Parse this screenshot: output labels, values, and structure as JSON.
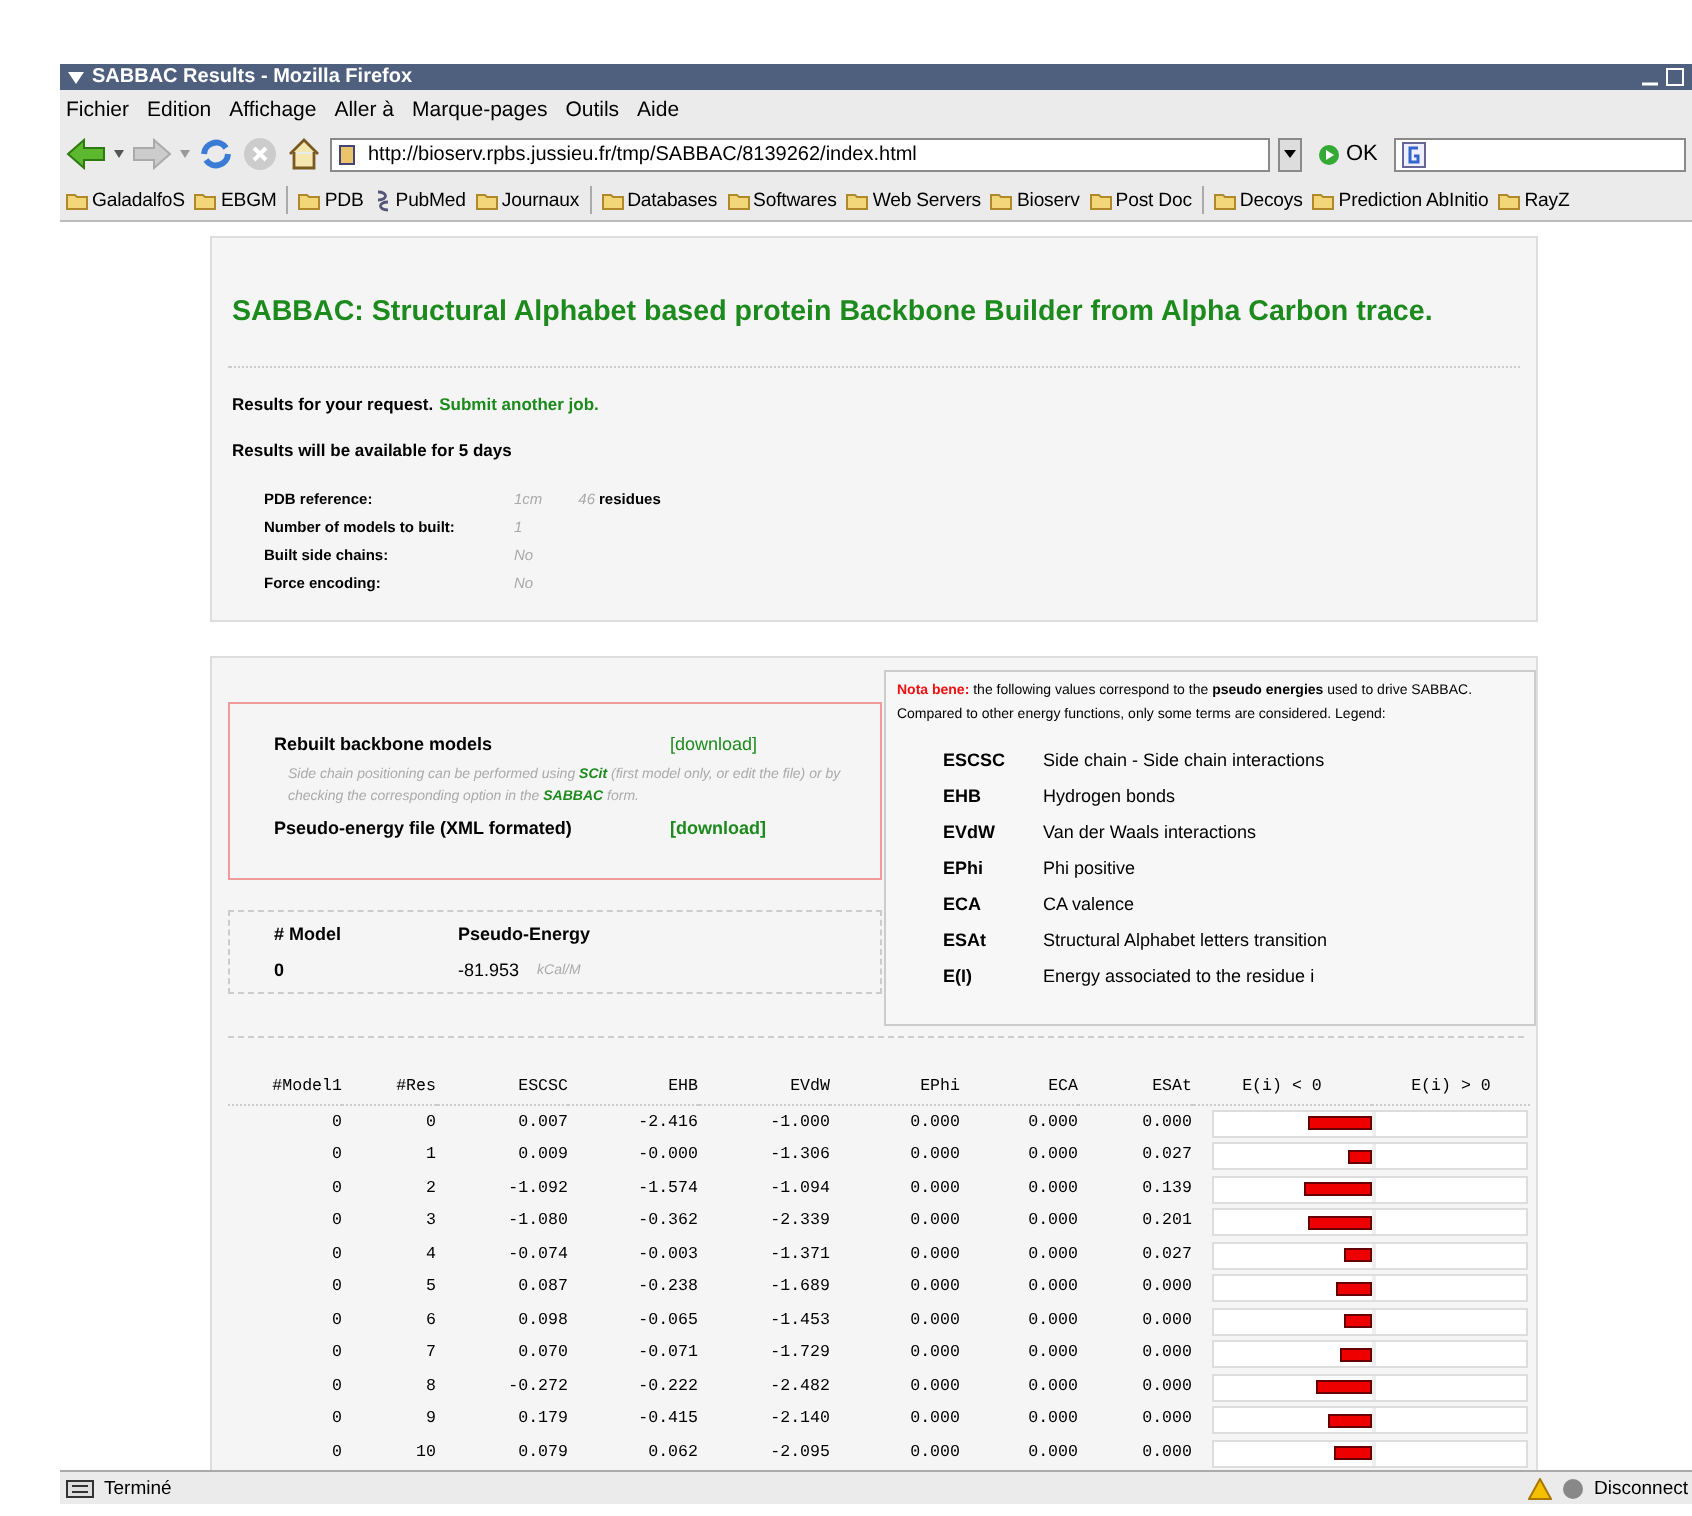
{
  "window": {
    "title": "SABBAC Results - Mozilla Firefox"
  },
  "menu": [
    "Fichier",
    "Edition",
    "Affichage",
    "Aller à",
    "Marque-pages",
    "Outils",
    "Aide"
  ],
  "toolbar": {
    "url": "http://bioserv.rpbs.jussieu.fr/tmp/SABBAC/8139262/index.html",
    "go": "OK"
  },
  "bookmarks": [
    {
      "label": "GaladalfoS",
      "kind": "folder",
      "separator_after": false
    },
    {
      "label": "EBGM",
      "kind": "folder",
      "separator_after": true
    },
    {
      "label": "PDB",
      "kind": "folder",
      "separator_after": false
    },
    {
      "label": "PubMed",
      "kind": "link",
      "separator_after": false
    },
    {
      "label": "Journaux",
      "kind": "folder",
      "separator_after": true
    },
    {
      "label": "Databases",
      "kind": "folder",
      "separator_after": false
    },
    {
      "label": "Softwares",
      "kind": "folder",
      "separator_after": false
    },
    {
      "label": "Web Servers",
      "kind": "folder",
      "separator_after": false
    },
    {
      "label": "Bioserv",
      "kind": "folder",
      "separator_after": false
    },
    {
      "label": "Post Doc",
      "kind": "folder",
      "separator_after": true
    },
    {
      "label": "Decoys",
      "kind": "folder",
      "separator_after": false
    },
    {
      "label": "Prediction AbInitio",
      "kind": "folder",
      "separator_after": false
    },
    {
      "label": "RayZ",
      "kind": "folder",
      "separator_after": false
    }
  ],
  "page": {
    "heading": "SABBAC: Structural Alphabet based protein Backbone Builder from Alpha Carbon trace.",
    "request": {
      "text": "Results for your request.",
      "link": "Submit another job."
    },
    "availability": "Results will be available for 5 days",
    "parameters": [
      {
        "label": "PDB reference:",
        "value": "1cm",
        "count": "46",
        "unit": "residues"
      },
      {
        "label": "Number of models to built:",
        "value": "1"
      },
      {
        "label": "Built side chains:",
        "value": "No"
      },
      {
        "label": "Force encoding:",
        "value": "No"
      }
    ],
    "downloads": [
      {
        "label": "Rebuilt backbone models",
        "link": "[download]",
        "note": [
          {
            "kind": "text",
            "text": "Side chain positioning can be performed using "
          },
          {
            "kind": "link",
            "text": "SCit"
          },
          {
            "kind": "text",
            "text": " (first model only, or edit the file) or by checking the corresponding option in the "
          },
          {
            "kind": "link",
            "text": "SABBAC"
          },
          {
            "kind": "text",
            "text": " form."
          }
        ]
      },
      {
        "label": "Pseudo-energy file (XML formated)",
        "link": "[download]"
      }
    ],
    "energy_table": {
      "columns": [
        "# Model",
        "Pseudo-Energy"
      ],
      "rows": [
        {
          "model": "0",
          "energy": "-81.953",
          "unit": "kCal/M"
        }
      ]
    },
    "nota": {
      "text": "**Nota bene:** the following values correspond to the **pseudo energies** used to drive SABBAC. Compared to other energy functions, only some terms are considered. Legend:"
    },
    "legend": [
      {
        "term": "ESCSC",
        "meaning": "Side chain - Side chain interactions"
      },
      {
        "term": "EHB",
        "meaning": "Hydrogen bonds"
      },
      {
        "term": "EVdW",
        "meaning": "Van der Waals interactions"
      },
      {
        "term": "EPhi",
        "meaning": "Phi positive"
      },
      {
        "term": "ECA",
        "meaning": "CA valence"
      },
      {
        "term": "ESAt",
        "meaning": "Structural Alphabet letters transition"
      },
      {
        "term": "E(I)",
        "meaning": "Energy associated to the residue i"
      }
    ],
    "table": {
      "columns": [
        "#Model1",
        "#Res",
        "ESCSC",
        "EHB",
        "EVdW",
        "EPhi",
        "ECA",
        "ESAt",
        "E(i) < 0",
        "E(i) > 0"
      ],
      "rows": [
        {
          "cells": [
            "0",
            "0",
            "0.007",
            "-2.416",
            "-1.000",
            "0.000",
            "0.000",
            "0.000"
          ],
          "level": 0.4
        },
        {
          "cells": [
            "0",
            "1",
            "0.009",
            "-0.000",
            "-1.306",
            "0.000",
            "0.000",
            "0.027"
          ],
          "level": 0.15
        },
        {
          "cells": [
            "0",
            "2",
            "-1.092",
            "-1.574",
            "-1.094",
            "0.000",
            "0.000",
            "0.139"
          ],
          "level": 0.43
        },
        {
          "cells": [
            "0",
            "3",
            "-1.080",
            "-0.362",
            "-2.339",
            "0.000",
            "0.000",
            "0.201"
          ],
          "level": 0.41
        },
        {
          "cells": [
            "0",
            "4",
            "-0.074",
            "-0.003",
            "-1.371",
            "0.000",
            "0.000",
            "0.027"
          ],
          "level": 0.18
        },
        {
          "cells": [
            "0",
            "5",
            "0.087",
            "-0.238",
            "-1.689",
            "0.000",
            "0.000",
            "0.000"
          ],
          "level": 0.23
        },
        {
          "cells": [
            "0",
            "6",
            "0.098",
            "-0.065",
            "-1.453",
            "0.000",
            "0.000",
            "0.000"
          ],
          "level": 0.18
        },
        {
          "cells": [
            "0",
            "7",
            "0.070",
            "-0.071",
            "-1.729",
            "0.000",
            "0.000",
            "0.000"
          ],
          "level": 0.2
        },
        {
          "cells": [
            "0",
            "8",
            "-0.272",
            "-0.222",
            "-2.482",
            "0.000",
            "0.000",
            "0.000"
          ],
          "level": 0.35
        },
        {
          "cells": [
            "0",
            "9",
            "0.179",
            "-0.415",
            "-2.140",
            "0.000",
            "0.000",
            "0.000"
          ],
          "level": 0.28
        },
        {
          "cells": [
            "0",
            "10",
            "0.079",
            "0.062",
            "-2.095",
            "0.000",
            "0.000",
            "0.000"
          ],
          "level": 0.24
        }
      ]
    }
  },
  "status_bar": {
    "text": "Terminé",
    "connection": "Disconnect"
  }
}
